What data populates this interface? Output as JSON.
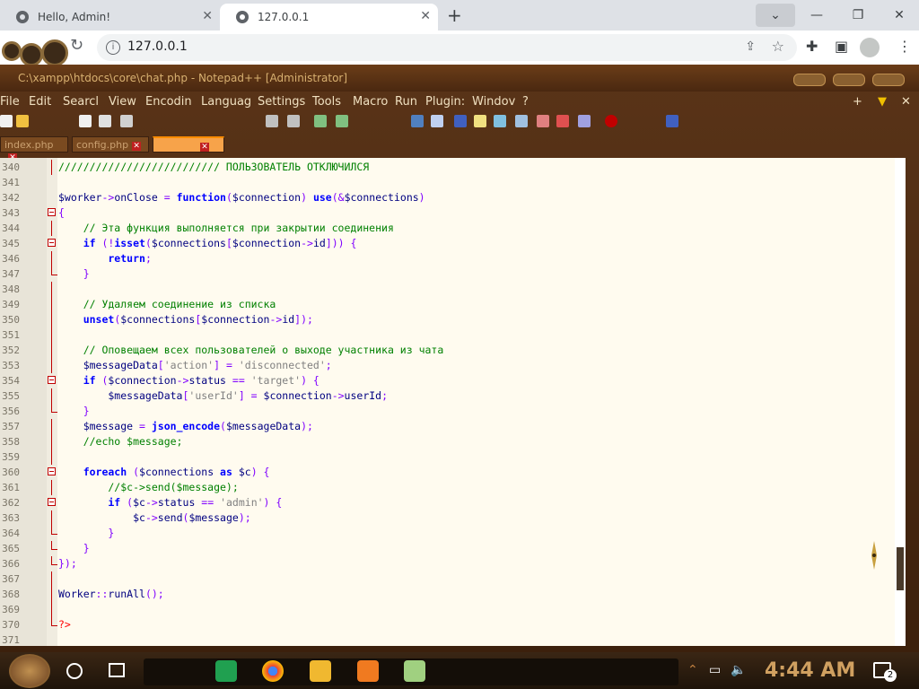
{
  "browser": {
    "tabs": [
      {
        "title": "Hello, Admin!"
      },
      {
        "title": "127.0.0.1"
      }
    ],
    "url": "127.0.0.1"
  },
  "notepad": {
    "title": "C:\\xampp\\htdocs\\core\\chat.php - Notepad++ [Administrator]",
    "menu": [
      "File",
      "Edit",
      "Searcl",
      "View",
      "Encodin",
      "Languag",
      "Settings",
      "Tools",
      "Macro",
      "Run",
      "Plugin:",
      "Windov",
      "?"
    ],
    "doc_tabs": [
      {
        "name": "index.php",
        "active": false
      },
      {
        "name": "config.php",
        "active": false
      },
      {
        "name": "",
        "active": true
      }
    ],
    "lines": [
      {
        "n": "340",
        "fold": "line",
        "parts": [
          [
            "c-com",
            "////////////////////////// ПОЛЬЗОВАТЕЛЬ ОТКЛЮЧИЛСЯ"
          ]
        ]
      },
      {
        "n": "341",
        "fold": "",
        "parts": []
      },
      {
        "n": "342",
        "fold": "",
        "parts": [
          [
            "c-var",
            "$worker"
          ],
          [
            "c-op",
            "->"
          ],
          [
            "c-var",
            "onClose "
          ],
          [
            "c-op",
            "= "
          ],
          [
            "c-kw",
            "function"
          ],
          [
            "c-op",
            "("
          ],
          [
            "c-var",
            "$connection"
          ],
          [
            "c-op",
            ") "
          ],
          [
            "c-kw",
            "use"
          ],
          [
            "c-op",
            "(&"
          ],
          [
            "c-var",
            "$connections"
          ],
          [
            "c-op",
            ")"
          ]
        ]
      },
      {
        "n": "343",
        "fold": "open",
        "parts": [
          [
            "c-op",
            "{"
          ]
        ]
      },
      {
        "n": "344",
        "fold": "line",
        "parts": [
          [
            "c-com",
            "    // Эта функция выполняется при закрытии соединения"
          ]
        ]
      },
      {
        "n": "345",
        "fold": "open",
        "parts": [
          [
            "c-kw",
            "    if "
          ],
          [
            "c-op",
            "(!"
          ],
          [
            "c-kw",
            "isset"
          ],
          [
            "c-op",
            "("
          ],
          [
            "c-var",
            "$connections"
          ],
          [
            "c-op",
            "["
          ],
          [
            "c-var",
            "$connection"
          ],
          [
            "c-op",
            "->"
          ],
          [
            "c-var",
            "id"
          ],
          [
            "c-op",
            "])) {"
          ]
        ]
      },
      {
        "n": "346",
        "fold": "line",
        "parts": [
          [
            "c-kw",
            "        return"
          ],
          [
            "c-op",
            ";"
          ]
        ]
      },
      {
        "n": "347",
        "fold": "end",
        "parts": [
          [
            "c-op",
            "    }"
          ]
        ]
      },
      {
        "n": "348",
        "fold": "line",
        "parts": []
      },
      {
        "n": "349",
        "fold": "line",
        "parts": [
          [
            "c-com",
            "    // Удаляем соединение из списка"
          ]
        ]
      },
      {
        "n": "350",
        "fold": "line",
        "parts": [
          [
            "c-kw",
            "    unset"
          ],
          [
            "c-op",
            "("
          ],
          [
            "c-var",
            "$connections"
          ],
          [
            "c-op",
            "["
          ],
          [
            "c-var",
            "$connection"
          ],
          [
            "c-op",
            "->"
          ],
          [
            "c-var",
            "id"
          ],
          [
            "c-op",
            "]);"
          ]
        ]
      },
      {
        "n": "351",
        "fold": "line",
        "parts": []
      },
      {
        "n": "352",
        "fold": "line",
        "parts": [
          [
            "c-com",
            "    // Оповещаем всех пользователей о выходе участника из чата"
          ]
        ]
      },
      {
        "n": "353",
        "fold": "line",
        "parts": [
          [
            "c-var",
            "    $messageData"
          ],
          [
            "c-op",
            "["
          ],
          [
            "c-str",
            "'action'"
          ],
          [
            "c-op",
            "] = "
          ],
          [
            "c-str",
            "'disconnected'"
          ],
          [
            "c-op",
            ";"
          ]
        ]
      },
      {
        "n": "354",
        "fold": "open",
        "parts": [
          [
            "c-kw",
            "    if "
          ],
          [
            "c-op",
            "("
          ],
          [
            "c-var",
            "$connection"
          ],
          [
            "c-op",
            "->"
          ],
          [
            "c-var",
            "status "
          ],
          [
            "c-op",
            "== "
          ],
          [
            "c-str",
            "'target'"
          ],
          [
            "c-op",
            ") {"
          ]
        ]
      },
      {
        "n": "355",
        "fold": "line",
        "parts": [
          [
            "c-var",
            "        $messageData"
          ],
          [
            "c-op",
            "["
          ],
          [
            "c-str",
            "'userId'"
          ],
          [
            "c-op",
            "] = "
          ],
          [
            "c-var",
            "$connection"
          ],
          [
            "c-op",
            "->"
          ],
          [
            "c-var",
            "userId"
          ],
          [
            "c-op",
            ";"
          ]
        ]
      },
      {
        "n": "356",
        "fold": "end",
        "parts": [
          [
            "c-op",
            "    }"
          ]
        ]
      },
      {
        "n": "357",
        "fold": "line",
        "parts": [
          [
            "c-var",
            "    $message "
          ],
          [
            "c-op",
            "= "
          ],
          [
            "c-kw",
            "json_encode"
          ],
          [
            "c-op",
            "("
          ],
          [
            "c-var",
            "$messageData"
          ],
          [
            "c-op",
            ");"
          ]
        ]
      },
      {
        "n": "358",
        "fold": "line",
        "parts": [
          [
            "c-com",
            "    //echo $message;"
          ]
        ]
      },
      {
        "n": "359",
        "fold": "line",
        "parts": []
      },
      {
        "n": "360",
        "fold": "open",
        "parts": [
          [
            "c-kw",
            "    foreach "
          ],
          [
            "c-op",
            "("
          ],
          [
            "c-var",
            "$connections "
          ],
          [
            "c-kw",
            "as "
          ],
          [
            "c-var",
            "$c"
          ],
          [
            "c-op",
            ") {"
          ]
        ]
      },
      {
        "n": "361",
        "fold": "line",
        "parts": [
          [
            "c-com",
            "        //$c->send($message);"
          ]
        ]
      },
      {
        "n": "362",
        "fold": "open",
        "parts": [
          [
            "c-kw",
            "        if "
          ],
          [
            "c-op",
            "("
          ],
          [
            "c-var",
            "$c"
          ],
          [
            "c-op",
            "->"
          ],
          [
            "c-var",
            "status "
          ],
          [
            "c-op",
            "== "
          ],
          [
            "c-str",
            "'admin'"
          ],
          [
            "c-op",
            ") {"
          ]
        ]
      },
      {
        "n": "363",
        "fold": "line",
        "parts": [
          [
            "c-var",
            "            $c"
          ],
          [
            "c-op",
            "->"
          ],
          [
            "c-var",
            "send"
          ],
          [
            "c-op",
            "("
          ],
          [
            "c-var",
            "$message"
          ],
          [
            "c-op",
            ");"
          ]
        ]
      },
      {
        "n": "364",
        "fold": "end",
        "parts": [
          [
            "c-op",
            "        }"
          ]
        ]
      },
      {
        "n": "365",
        "fold": "end",
        "parts": [
          [
            "c-op",
            "    }"
          ]
        ]
      },
      {
        "n": "366",
        "fold": "end",
        "parts": [
          [
            "c-op",
            "});"
          ]
        ]
      },
      {
        "n": "367",
        "fold": "line",
        "parts": []
      },
      {
        "n": "368",
        "fold": "line",
        "parts": [
          [
            "c-var",
            "Worker"
          ],
          [
            "c-op",
            "::"
          ],
          [
            "c-var",
            "runAll"
          ],
          [
            "c-op",
            "();"
          ]
        ]
      },
      {
        "n": "369",
        "fold": "line",
        "parts": []
      },
      {
        "n": "370",
        "fold": "end",
        "parts": [
          [
            "c-tag",
            "?>"
          ]
        ]
      },
      {
        "n": "371",
        "fold": "",
        "parts": []
      }
    ]
  },
  "taskbar": {
    "clock": "4:44 AM",
    "notifications": "2"
  }
}
